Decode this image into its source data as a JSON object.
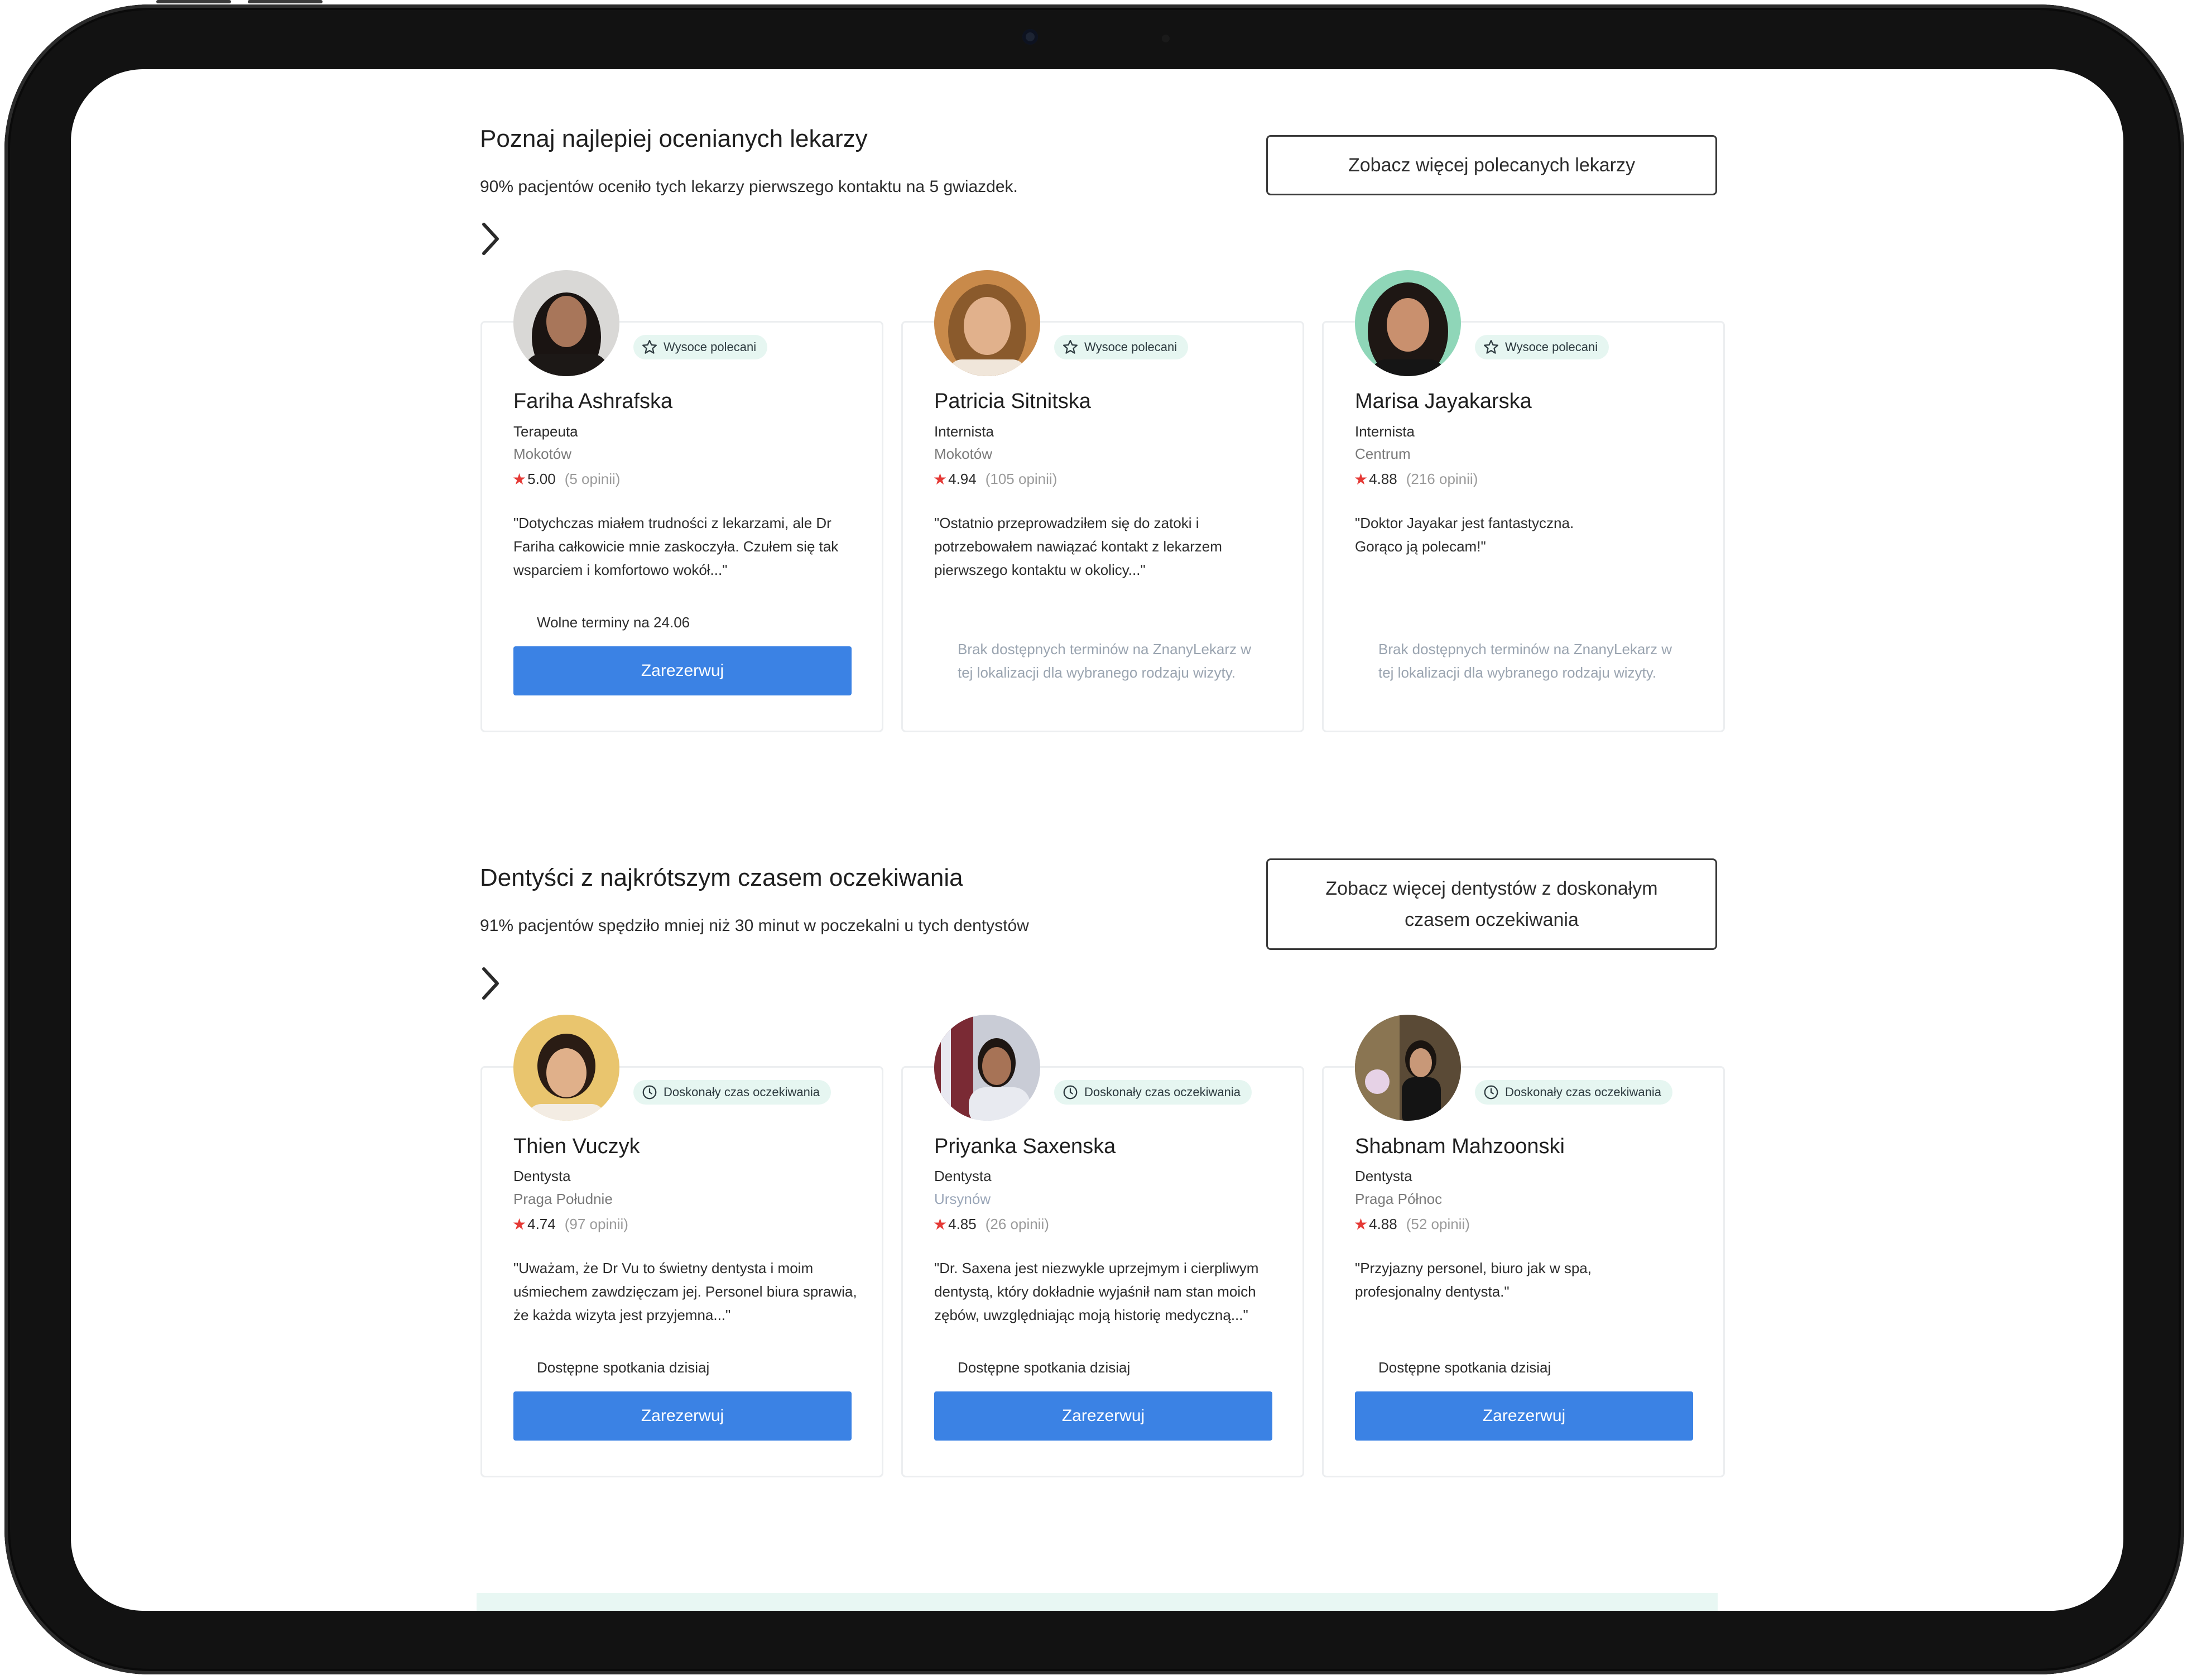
{
  "colors": {
    "accent": "#3b82e4",
    "badge_bg": "#e6f6f1",
    "star": "#e53935"
  },
  "sections": [
    {
      "title": "Poznaj najlepiej ocenianych lekarzy",
      "subtitle": "90% pacjentów oceniło tych lekarzy pierwszego kontaktu na 5 gwiazdek.",
      "more_button": "Zobacz więcej polecanych lekarzy",
      "cards": [
        {
          "badge": "Wysoce polecani",
          "badge_icon": "star-outline-icon",
          "name": "Fariha Ashrafska",
          "specialty": "Terapeuta",
          "location": "Mokotów",
          "rating": "5.00",
          "reviews": "(5 opinii)",
          "quote": "\"Dotychczas miałem trudności z lekarzami, ale Dr Fariha całkowicie mnie zaskoczyła. Czułem się tak wsparciem i komfortowo wokół...\"",
          "availability": "Wolne terminy na 24.06",
          "button": "Zarezerwuj",
          "no_slots": ""
        },
        {
          "badge": "Wysoce polecani",
          "badge_icon": "star-outline-icon",
          "name": "Patricia Sitnitska",
          "specialty": "Internista",
          "location": "Mokotów",
          "rating": "4.94",
          "reviews": "(105 opinii)",
          "quote": "\"Ostatnio przeprowadziłem się do zatoki i potrzebowałem nawiązać kontakt z lekarzem pierwszego kontaktu w okolicy...\"",
          "availability": "",
          "button": "",
          "no_slots": "Brak dostępnych terminów na ZnanyLekarz w tej lokalizacji dla wybranego rodzaju wizyty."
        },
        {
          "badge": "Wysoce polecani",
          "badge_icon": "star-outline-icon",
          "name": "Marisa Jayakarska",
          "specialty": "Internista",
          "location": "Centrum",
          "rating": "4.88",
          "reviews": "(216 opinii)",
          "quote": "\"Doktor Jayakar jest fantastyczna. Gorąco ją polecam!\"",
          "availability": "",
          "button": "",
          "no_slots": "Brak dostępnych terminów na ZnanyLekarz w tej lokalizacji dla wybranego rodzaju wizyty."
        }
      ]
    },
    {
      "title": "Dentyści z najkrótszym czasem oczekiwania",
      "subtitle": "91% pacjentów spędziło mniej niż 30 minut w poczekalni u tych dentystów",
      "more_button_lines": [
        "Zobacz więcej dentystów z doskonałym",
        "czasem oczekiwania"
      ],
      "cards": [
        {
          "badge": "Doskonały czas oczekiwania",
          "badge_icon": "clock-icon",
          "name": "Thien Vuczyk",
          "specialty": "Dentysta",
          "location": "Praga Południe",
          "rating": "4.74",
          "reviews": "(97 opinii)",
          "quote": "\"Uważam, że Dr Vu to świetny dentysta i moim uśmiechem zawdzięczam jej. Personel biura sprawia, że każda wizyta jest przyjemna...\"",
          "availability": "Dostępne spotkania dzisiaj",
          "button": "Zarezerwuj"
        },
        {
          "badge": "Doskonały czas oczekiwania",
          "badge_icon": "clock-icon",
          "name": "Priyanka Saxenska",
          "specialty": "Dentysta",
          "location": "Ursynów",
          "rating": "4.85",
          "reviews": "(26 opinii)",
          "quote": "\"Dr. Saxena jest niezwykle uprzejmym i cierpliwym dentystą, który dokładnie wyjaśnił nam stan moich zębów, uwzględniając moją historię medyczną...\"",
          "availability": "Dostępne spotkania dzisiaj",
          "button": "Zarezerwuj"
        },
        {
          "badge": "Doskonały czas oczekiwania",
          "badge_icon": "clock-icon",
          "name": "Shabnam Mahzoonski",
          "specialty": "Dentysta",
          "location": "Praga Północ",
          "rating": "4.88",
          "reviews": "(52 opinii)",
          "quote": "\"Przyjazny personel, biuro jak w spa, profesjonalny dentysta.\"",
          "availability": "Dostępne spotkania dzisiaj",
          "button": "Zarezerwuj"
        }
      ]
    }
  ]
}
